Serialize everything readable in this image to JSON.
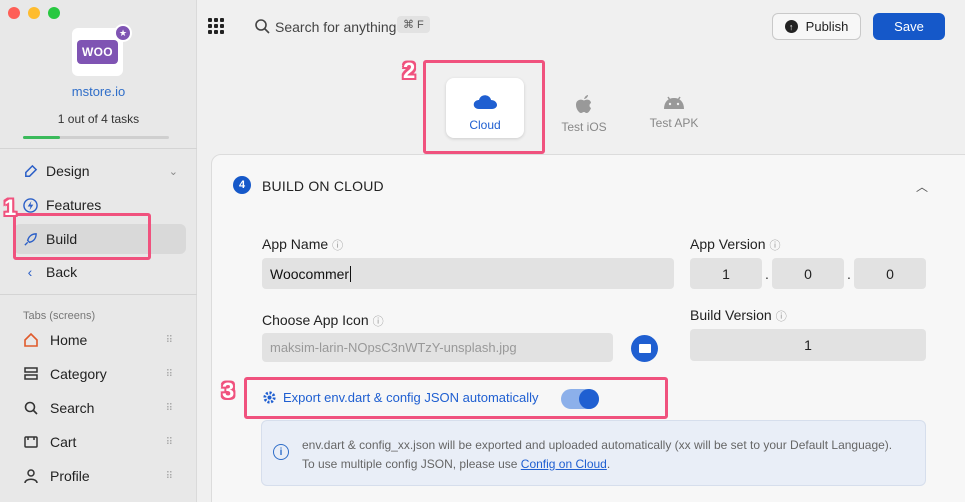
{
  "sidebar": {
    "store_name": "mstore.io",
    "logo_text": "WOO",
    "tasks_text": "1 out of 4 tasks",
    "tasks_progress": 0.25,
    "nav": [
      {
        "label": "Design",
        "icon": "brush-icon"
      },
      {
        "label": "Features",
        "icon": "bolt-icon"
      },
      {
        "label": "Build",
        "icon": "rocket-icon"
      },
      {
        "label": "Back",
        "icon": "chevron-left-icon"
      }
    ],
    "tabs_label": "Tabs (screens)",
    "tabs": [
      {
        "label": "Home",
        "icon": "home-icon"
      },
      {
        "label": "Category",
        "icon": "category-icon"
      },
      {
        "label": "Search",
        "icon": "search-icon"
      },
      {
        "label": "Cart",
        "icon": "cart-icon"
      },
      {
        "label": "Profile",
        "icon": "profile-icon"
      }
    ]
  },
  "topbar": {
    "search_placeholder": "Search for anything",
    "shortcut": "⌘ F",
    "publish_label": "Publish",
    "save_label": "Save"
  },
  "targets": [
    {
      "label": "Cloud",
      "icon": "cloud-icon",
      "selected": true
    },
    {
      "label": "Test iOS",
      "icon": "apple-icon",
      "selected": false
    },
    {
      "label": "Test APK",
      "icon": "android-icon",
      "selected": false
    }
  ],
  "build": {
    "step": "4",
    "title": "BUILD ON CLOUD",
    "app_name_label": "App Name",
    "app_name_value": "Woocommer",
    "app_version_label": "App Version",
    "app_version": [
      "1",
      "0",
      "0"
    ],
    "app_icon_label": "Choose App Icon",
    "app_icon_value": "maksim-larin-NOpsC3nWTzY-unsplash.jpg",
    "build_version_label": "Build Version",
    "build_version_value": "1",
    "export_label": "Export env.dart & config JSON automatically",
    "export_enabled": true,
    "info_text": "env.dart & config_xx.json will be exported and uploaded automatically (xx will be set to your Default Language). To use multiple config JSON, please use ",
    "info_link": "Config on Cloud",
    "info_end": "."
  },
  "annotations": [
    "1",
    "2",
    "3"
  ],
  "colors": {
    "accent": "#1558c9",
    "annotation": "#f0527e"
  }
}
